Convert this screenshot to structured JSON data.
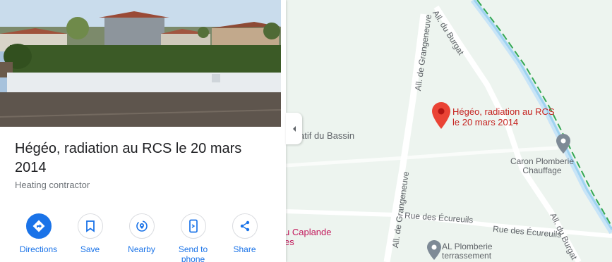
{
  "place": {
    "title": "Hégéo, radiation au RCS le 20 mars 2014",
    "category": "Heating contractor"
  },
  "actions": [
    {
      "label": "Directions",
      "icon": "directions-icon"
    },
    {
      "label": "Save",
      "icon": "bookmark-icon"
    },
    {
      "label": "Nearby",
      "icon": "nearby-icon"
    },
    {
      "label": "Send to phone",
      "icon": "phone-icon"
    },
    {
      "label": "Share",
      "icon": "share-icon"
    }
  ],
  "map": {
    "pin_label": "Hégéo, radiation au RCS le 20 mars 2014",
    "labels": {
      "grangeneuve_top": "All. de Grangeneuve",
      "grangeneuve_bottom": "All. de Grangeneuve",
      "burgat_top": "All. du Burgat",
      "burgat_bottom": "All. du Burgat",
      "ecureuils_left": "Rue des Écureuils",
      "ecureuils_right": "Rue des Écureuils",
      "bassin": "atif du Bassin",
      "caplande": "u Caplande",
      "caplande_2": "es"
    },
    "pois": {
      "caron": "Caron Plomberie Chauffage",
      "al": "AL Plomberie terrassement"
    }
  },
  "colors": {
    "accent": "#1a73e8",
    "pin": "#ea4335",
    "water": "#9fd3f0",
    "boundary": "#34a853"
  }
}
